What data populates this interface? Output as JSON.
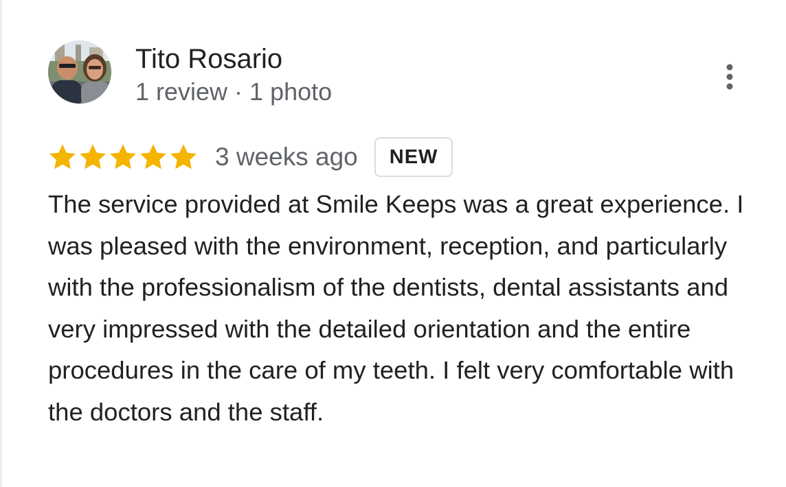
{
  "reviewer": {
    "name": "Tito Rosario",
    "meta": "1 review · 1 photo",
    "avatar_icon": "profile-photo"
  },
  "menu": {
    "icon": "more-vert-icon"
  },
  "rating": {
    "stars": 5,
    "max_stars": 5,
    "star_color": "#F4B400",
    "time_ago": "3 weeks ago",
    "badge": "NEW"
  },
  "review": {
    "text": "The service provided at Smile Keeps was a great experience. I was pleased with the environment, reception, and particularly with the professionalism of the dentists, dental assistants and very impressed with the detailed orientation and the entire procedures in the care of my teeth. I felt very comfortable with the doctors and the staff."
  }
}
